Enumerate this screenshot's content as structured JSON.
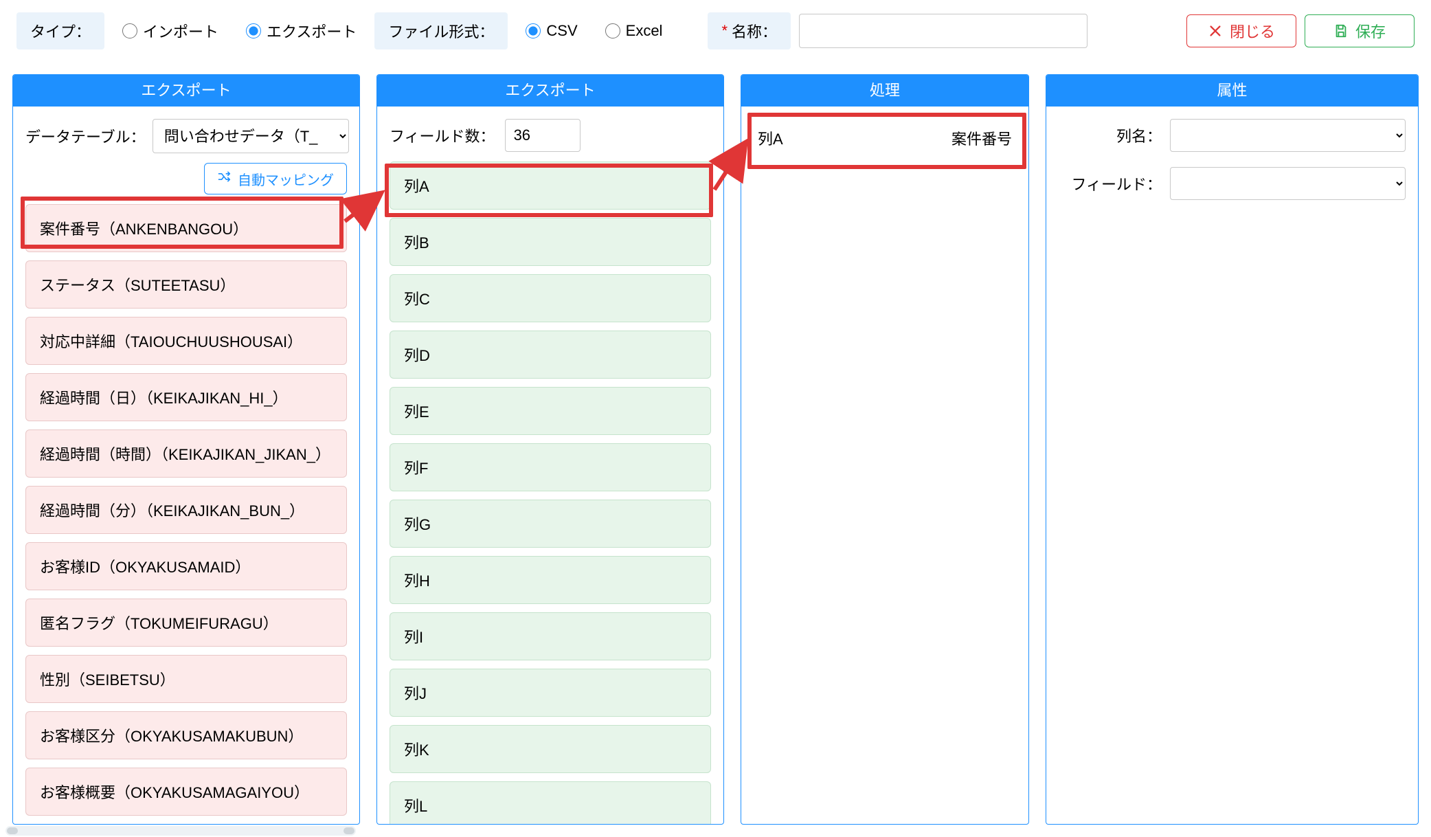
{
  "topbar": {
    "type_label": "タイプ：",
    "type_import": "インポート",
    "type_export": "エクスポート",
    "type_selected": "export",
    "format_label": "ファイル形式：",
    "format_csv": "CSV",
    "format_excel": "Excel",
    "format_selected": "csv",
    "name_label": "名称：",
    "name_value": "",
    "close_label": "閉じる",
    "save_label": "保存"
  },
  "panel1": {
    "title": "エクスポート",
    "datatable_label": "データテーブル：",
    "datatable_selected": "問い合わせデータ（T_",
    "automap_label": "自動マッピング",
    "fields": [
      "案件番号（ANKENBANGOU）",
      "ステータス（SUTEETASU）",
      "対応中詳細（TAIOUCHUUSHOUSAI）",
      "経過時間（日）（KEIKAJIKAN_HI_）",
      "経過時間（時間）（KEIKAJIKAN_JIKAN_）",
      "経過時間（分）（KEIKAJIKAN_BUN_）",
      "お客様ID（OKYAKUSAMAID）",
      "匿名フラグ（TOKUMEIFURAGU）",
      "性別（SEIBETSU）",
      "お客様区分（OKYAKUSAMAKUBUN）",
      "お客様概要（OKYAKUSAMAGAIYOU）"
    ]
  },
  "panel2": {
    "title": "エクスポート",
    "fieldcount_label": "フィールド数：",
    "fieldcount_value": "36",
    "columns": [
      "列A",
      "列B",
      "列C",
      "列D",
      "列E",
      "列F",
      "列G",
      "列H",
      "列I",
      "列J",
      "列K",
      "列L"
    ]
  },
  "panel3": {
    "title": "処理",
    "rows": [
      {
        "col": "列A",
        "field": "案件番号"
      }
    ]
  },
  "panel4": {
    "title": "属性",
    "colname_label": "列名：",
    "colname_value": "",
    "field_label": "フィールド：",
    "field_value": ""
  }
}
